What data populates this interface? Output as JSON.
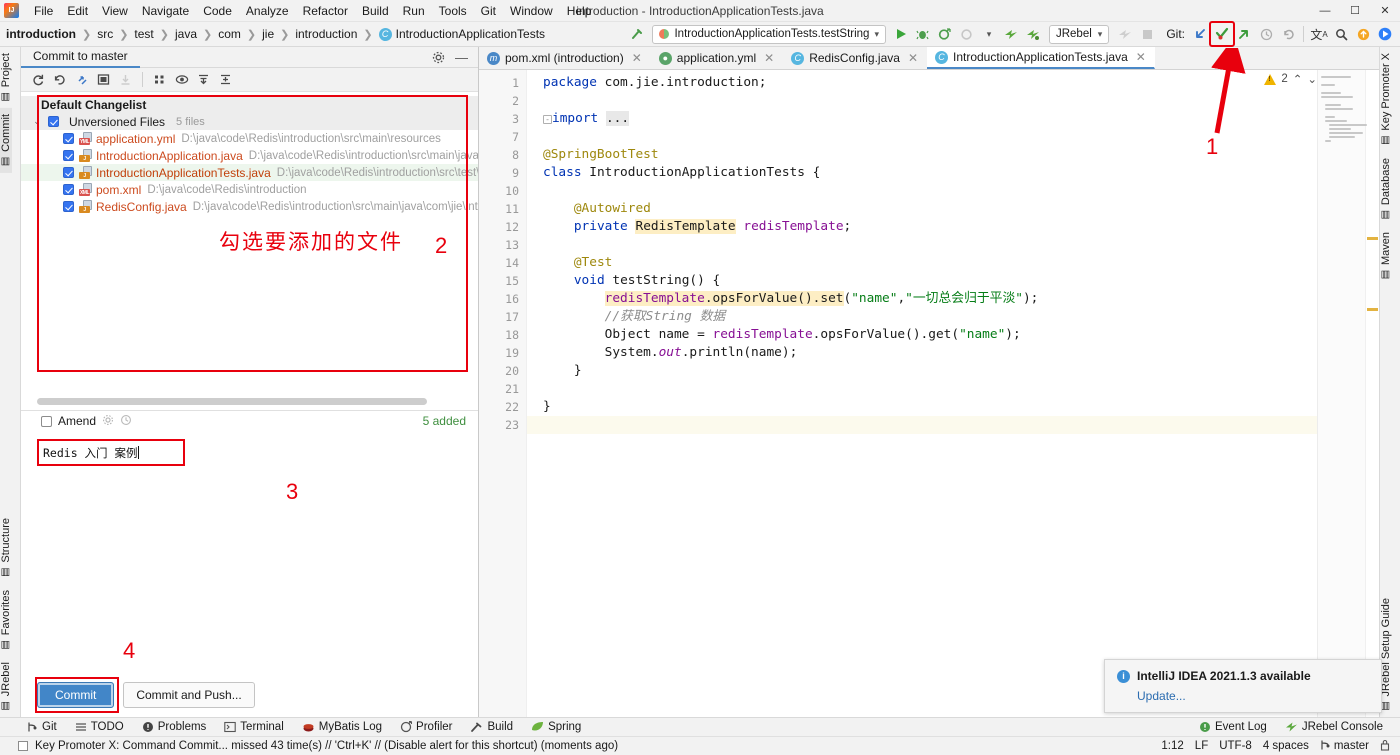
{
  "window": {
    "title": "introduction - IntroductionApplicationTests.java",
    "minimize": "—",
    "maximize": "☐",
    "close": "✕"
  },
  "menu": {
    "items": [
      "File",
      "Edit",
      "View",
      "Navigate",
      "Code",
      "Analyze",
      "Refactor",
      "Build",
      "Run",
      "Tools",
      "Git",
      "Window",
      "Help"
    ]
  },
  "breadcrumb": {
    "items": [
      "introduction",
      "src",
      "test",
      "java",
      "com",
      "jie",
      "introduction",
      "IntroductionApplicationTests"
    ],
    "class_icon": "class-icon",
    "separator": "❯"
  },
  "toolbar": {
    "build_icon": "hammer-icon",
    "run_config": "IntroductionApplicationTests.testString",
    "run_config_caret": "▾",
    "run_icon": "run-icon",
    "debug_icon": "debug-icon",
    "run_coverage_icon": "run-with-coverage-icon",
    "profile_icon": "profile-icon",
    "profile_caret": "▾",
    "jrebel_run_icon": "jrebel-run-icon",
    "jrebel_debug_icon": "jrebel-debug-icon",
    "jrebel_label": "JRebel",
    "jrebel_caret": "▾",
    "stop_icon": "stop-icon",
    "git_label": "Git:",
    "update_project_icon": "update-project-icon",
    "commit_icon": "commit-icon",
    "push_icon": "push-icon",
    "history_icon": "history-icon",
    "rollback_icon": "rollback-icon",
    "translate_icon": "translate-icon",
    "search_icon": "search-everywhere-icon",
    "notification_icon": "notification-icon",
    "ide_icon": "ide-icon"
  },
  "left_strip": {
    "top": [
      {
        "label": "Project",
        "icon": "project-icon",
        "active": false
      },
      {
        "label": "Commit",
        "icon": "commit-icon",
        "active": true
      }
    ],
    "bottom": [
      {
        "label": "Structure",
        "icon": "structure-icon"
      },
      {
        "label": "Favorites",
        "icon": "star-icon"
      },
      {
        "label": "JRebel",
        "icon": "jrebel-icon"
      }
    ]
  },
  "right_strip": {
    "top": [
      {
        "label": "Key Promoter X",
        "icon": "key-promoter-icon"
      },
      {
        "label": "Database",
        "icon": "database-icon"
      },
      {
        "label": "Maven",
        "icon": "maven-icon"
      }
    ],
    "bottom": [
      {
        "label": "JRebel Setup Guide",
        "icon": "jrebel-icon"
      }
    ]
  },
  "commit_panel": {
    "tab_title": "Commit to master",
    "settings_icon": "gear-icon",
    "hide_icon": "minimize-icon",
    "toolbar_icons": [
      "refresh-icon",
      "rollback-icon",
      "shelve-icon",
      "diff-icon",
      "download-icon",
      "group-by-icon",
      "preview-icon",
      "expand-all-icon",
      "collapse-all-icon"
    ],
    "changelist_title": "Default Changelist",
    "group": {
      "label": "Unversioned Files",
      "count": "5 files",
      "chevron": "⌄"
    },
    "files": [
      {
        "name": "application.yml",
        "path": "D:\\java\\code\\Redis\\introduction\\src\\main\\resources",
        "type": "YML",
        "selected": false
      },
      {
        "name": "IntroductionApplication.java",
        "path": "D:\\java\\code\\Redis\\introduction\\src\\main\\java\\com\\jie",
        "type": "J",
        "selected": false
      },
      {
        "name": "IntroductionApplicationTests.java",
        "path": "D:\\java\\code\\Redis\\introduction\\src\\test\\java\\com",
        "type": "J",
        "selected": true
      },
      {
        "name": "pom.xml",
        "path": "D:\\java\\code\\Redis\\introduction",
        "type": "XML",
        "selected": false
      },
      {
        "name": "RedisConfig.java",
        "path": "D:\\java\\code\\Redis\\introduction\\src\\main\\java\\com\\jie\\introductio",
        "type": "J",
        "selected": false
      }
    ],
    "amend_label": "Amend",
    "amend_gear_icon": "gear-icon",
    "amend_history_icon": "history-icon",
    "added_count": "5 added",
    "commit_message": "Redis 入门 案例",
    "commit_button": "Commit",
    "commit_and_push_button": "Commit and Push..."
  },
  "annotations": [
    {
      "id": "1",
      "text": "1"
    },
    {
      "id": "2",
      "text": "2"
    },
    {
      "id": "3",
      "text": "3"
    },
    {
      "id": "4",
      "text": "4"
    },
    {
      "id": "cn",
      "text": "勾选要添加的文件"
    }
  ],
  "editor": {
    "tabs": [
      {
        "label": "pom.xml (introduction)",
        "icon_letter": "m",
        "icon_color": "#4a88c7",
        "active": false
      },
      {
        "label": "application.yml",
        "icon_letter": "●",
        "icon_color": "#5aa469",
        "active": false
      },
      {
        "label": "RedisConfig.java",
        "icon_letter": "C",
        "icon_color": "#56b6e0",
        "active": false
      },
      {
        "label": "IntroductionApplicationTests.java",
        "icon_letter": "C",
        "icon_color": "#56b6e0",
        "active": true
      }
    ],
    "close_glyph": "✕",
    "warning_count": "2",
    "warning_up": "⌃",
    "warning_down": "⌄",
    "lines": [
      {
        "num": "1",
        "marker": "",
        "html": "<span class=\"kw\">package</span> com.jie.introduction;"
      },
      {
        "num": "2",
        "marker": "",
        "html": ""
      },
      {
        "num": "3",
        "marker": "",
        "html": "<span class=\"fold\">-</span><span class=\"kw\">import</span> <span class=\"hl-ident\">...</span>"
      },
      {
        "num": "7",
        "marker": "",
        "html": ""
      },
      {
        "num": "8",
        "marker": "spring-leaf-icon",
        "html": "<span class=\"ann\">@SpringBootTest</span>"
      },
      {
        "num": "9",
        "marker": "run-test-icon",
        "html": "<span class=\"kw\">class</span> IntroductionApplicationTests {"
      },
      {
        "num": "10",
        "marker": "",
        "html": ""
      },
      {
        "num": "11",
        "marker": "",
        "html": "    <span class=\"ann\">@Autowired</span>"
      },
      {
        "num": "12",
        "marker": "spring-bean-icon",
        "html": "    <span class=\"kw\">private</span> <span class=\"hl-soft\">RedisTemplate</span> <span class=\"fld\">redisTemplate</span>;"
      },
      {
        "num": "13",
        "marker": "",
        "html": ""
      },
      {
        "num": "14",
        "marker": "",
        "html": "    <span class=\"ann\">@Test</span>"
      },
      {
        "num": "15",
        "marker": "run-test-icon",
        "html": "    <span class=\"kw\">void</span> testString() {"
      },
      {
        "num": "16",
        "marker": "",
        "html": "        <span class=\"hl-soft\"><span class=\"fld\">redisTemplate</span>.opsForValue().set</span>(<span class=\"str\">\"name\"</span>,<span class=\"str\">\"一切总会归于平淡\"</span>);"
      },
      {
        "num": "17",
        "marker": "",
        "html": "        <span class=\"cmt\">//获取String 数据</span>"
      },
      {
        "num": "18",
        "marker": "",
        "html": "        Object name = <span class=\"fld\">redisTemplate</span>.opsForValue().get(<span class=\"str\">\"name\"</span>);"
      },
      {
        "num": "19",
        "marker": "",
        "html": "        System.<span class=\"stat\">out</span>.println(name);"
      },
      {
        "num": "20",
        "marker": "",
        "html": "    }"
      },
      {
        "num": "21",
        "marker": "",
        "html": ""
      },
      {
        "num": "22",
        "marker": "",
        "html": "}"
      },
      {
        "num": "23",
        "marker": "",
        "html": "",
        "current": true
      }
    ]
  },
  "notification": {
    "icon": "info-icon",
    "title": "IntelliJ IDEA 2021.1.3 available",
    "link": "Update..."
  },
  "tool_windows": {
    "left": [
      {
        "label": "Git",
        "icon": "git-branch-icon"
      },
      {
        "label": "TODO",
        "icon": "todo-icon"
      },
      {
        "label": "Problems",
        "icon": "problems-icon"
      },
      {
        "label": "Terminal",
        "icon": "terminal-icon"
      },
      {
        "label": "MyBatis Log",
        "icon": "mybatis-icon"
      },
      {
        "label": "Profiler",
        "icon": "profiler-icon"
      },
      {
        "label": "Build",
        "icon": "build-icon"
      },
      {
        "label": "Spring",
        "icon": "spring-icon"
      }
    ],
    "right": [
      {
        "label": "Event Log",
        "icon": "event-log-icon"
      },
      {
        "label": "JRebel Console",
        "icon": "jrebel-icon"
      }
    ]
  },
  "statusbar": {
    "message": "Key Promoter X: Command Commit... missed 43 time(s) // 'Ctrl+K' // (Disable alert for this shortcut) (moments ago)",
    "caret_position": "1:12",
    "line_separator": "LF",
    "encoding": "UTF-8",
    "indent": "4 spaces",
    "branch": "master",
    "branch_icon": "git-branch-icon",
    "lock_icon": "lock-icon"
  },
  "colors": {
    "accent": "#4286c8",
    "annotation_red": "#e8000d",
    "added_green": "#3f8f3f",
    "file_orange": "#cc4b1f"
  }
}
